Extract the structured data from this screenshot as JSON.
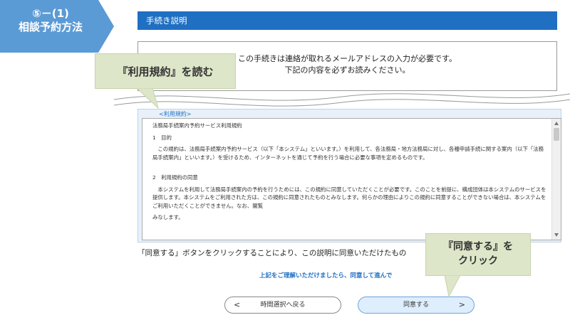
{
  "step": {
    "number": "⑤－(1)",
    "label": "相談予約方法"
  },
  "header": {
    "title": "手続き説明"
  },
  "notice": {
    "line1": "この手続きは連絡が取れるメールアドレスの入力が必要です。",
    "line2": "下記の内容を必ずお読みください。"
  },
  "terms": {
    "label": "<利用規約>",
    "title": "法務局手続案内予約サービス利用規約",
    "sec1_head": "1　目的",
    "sec1_body": "　この規約は、法務局手続案内予約サービス（以下「本システム」といいます。）を利用して、各法務局・地方法務局に対し、各種申請手続に関する案内（以下「法務局手続案内」といいます。）を受けるため、インターネットを通じて予約を行う場合に必要な事項を定めるものです。",
    "sec2_head": "2　利用規約の同意",
    "sec2_body": "　本システムを利用して法務局手続案内の予約を行うためには、この規約に同意していただくことが必要です。このことを前提に、構成団体は本システムのサービスを提供します。本システムをご利用された方は、この規約に同意されたものとみなします。何らかの理由によりこの規約に同意することができない場合は、本システムをご利用いただくことができません。なお、闇覧",
    "sec2_tail": "みなします。"
  },
  "agree_statement": "「同意する」ボタンをクリックすることにより、この説明に同意いただけたもの",
  "proceed_note": "上記をご理解いただけましたら、同意して進んで",
  "buttons": {
    "back": "時間選択へ戻る",
    "agree": "同意する",
    "back_chev": "<",
    "agree_chev": ">"
  },
  "callouts": {
    "read": "『利用規約』を読む",
    "agree_line1": "『同意する』を",
    "agree_line2": "クリック"
  },
  "colors": {
    "header_blue": "#1f6fc3",
    "step_tab_blue": "#5b9bd5",
    "callout_green": "#dde6c8"
  }
}
